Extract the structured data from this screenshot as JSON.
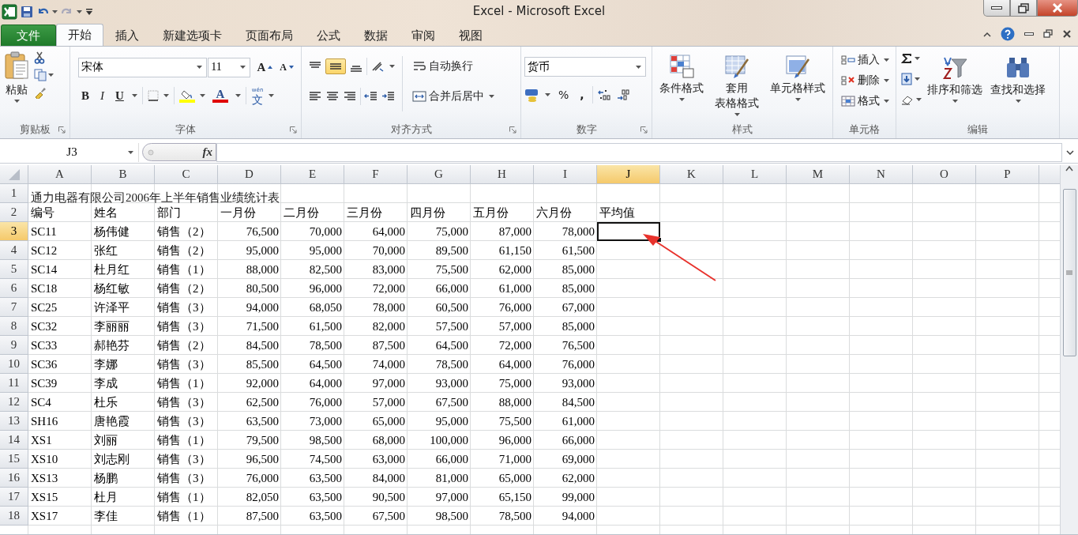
{
  "window": {
    "title": "Excel - Microsoft Excel"
  },
  "tabs": [
    {
      "label": "文件",
      "kind": "file",
      "selected": false
    },
    {
      "label": "开始",
      "kind": "tab",
      "selected": true
    },
    {
      "label": "插入",
      "kind": "tab",
      "selected": false
    },
    {
      "label": "新建选项卡",
      "kind": "tab",
      "selected": false
    },
    {
      "label": "页面布局",
      "kind": "tab",
      "selected": false
    },
    {
      "label": "公式",
      "kind": "tab",
      "selected": false
    },
    {
      "label": "数据",
      "kind": "tab",
      "selected": false
    },
    {
      "label": "审阅",
      "kind": "tab",
      "selected": false
    },
    {
      "label": "视图",
      "kind": "tab",
      "selected": false
    }
  ],
  "ribbon": {
    "clipboard": {
      "name": "剪贴板",
      "paste": "粘贴"
    },
    "font": {
      "name": "字体",
      "font_name": "宋体",
      "font_size": "11",
      "grow": "A",
      "shrink": "A",
      "bold": "B",
      "italic": "I",
      "underline": "U",
      "font_color": "A",
      "phonetic_top": "wén",
      "phonetic": "文"
    },
    "alignment": {
      "name": "对齐方式",
      "middle_align_selected": true,
      "wrap": "自动换行",
      "merge": "合并后居中"
    },
    "number": {
      "name": "数字",
      "format": "货币",
      "percent": "%",
      "comma": ","
    },
    "styles": {
      "name": "样式",
      "conditional": "条件格式",
      "table_1": "套用",
      "table_2": "表格格式",
      "cell_styles": "单元格样式"
    },
    "cells": {
      "name": "单元格",
      "insert": "插入",
      "delete": "删除",
      "format": "格式"
    },
    "editing": {
      "name": "编辑",
      "sort": "排序和筛选",
      "find": "查找和选择"
    }
  },
  "formula_bar": {
    "name_box": "J3",
    "function_label": "fx"
  },
  "sheet": {
    "columns": [
      {
        "label": "A",
        "selected": false
      },
      {
        "label": "B",
        "selected": false
      },
      {
        "label": "C",
        "selected": false
      },
      {
        "label": "D",
        "selected": false
      },
      {
        "label": "E",
        "selected": false
      },
      {
        "label": "F",
        "selected": false
      },
      {
        "label": "G",
        "selected": false
      },
      {
        "label": "H",
        "selected": false
      },
      {
        "label": "I",
        "selected": false
      },
      {
        "label": "J",
        "selected": true
      },
      {
        "label": "K",
        "selected": false
      },
      {
        "label": "L",
        "selected": false
      },
      {
        "label": "M",
        "selected": false
      },
      {
        "label": "N",
        "selected": false
      },
      {
        "label": "O",
        "selected": false
      },
      {
        "label": "P",
        "selected": false
      }
    ],
    "rows": [
      {
        "number": "1",
        "kind": "title",
        "selected": false,
        "cells": [
          "通力电器有限公司2006年上半年销售业绩统计表"
        ]
      },
      {
        "number": "2",
        "kind": "header",
        "selected": false,
        "cells": [
          "编号",
          "姓名",
          "部门",
          "一月份",
          "二月份",
          "三月份",
          "四月份",
          "五月份",
          "六月份",
          "平均值"
        ]
      },
      {
        "number": "3",
        "kind": "data",
        "selected": true,
        "cells": [
          "SC11",
          "杨伟健",
          "销售（2）",
          "76,500",
          "70,000",
          "64,000",
          "75,000",
          "87,000",
          "78,000"
        ]
      },
      {
        "number": "4",
        "kind": "data",
        "selected": false,
        "cells": [
          "SC12",
          "张红",
          "销售（2）",
          "95,000",
          "95,000",
          "70,000",
          "89,500",
          "61,150",
          "61,500"
        ]
      },
      {
        "number": "5",
        "kind": "data",
        "selected": false,
        "cells": [
          "SC14",
          "杜月红",
          "销售（1）",
          "88,000",
          "82,500",
          "83,000",
          "75,500",
          "62,000",
          "85,000"
        ]
      },
      {
        "number": "6",
        "kind": "data",
        "selected": false,
        "cells": [
          "SC18",
          "杨红敏",
          "销售（2）",
          "80,500",
          "96,000",
          "72,000",
          "66,000",
          "61,000",
          "85,000"
        ]
      },
      {
        "number": "7",
        "kind": "data",
        "selected": false,
        "cells": [
          "SC25",
          "许泽平",
          "销售（3）",
          "94,000",
          "68,050",
          "78,000",
          "60,500",
          "76,000",
          "67,000"
        ]
      },
      {
        "number": "8",
        "kind": "data",
        "selected": false,
        "cells": [
          "SC32",
          "李丽丽",
          "销售（3）",
          "71,500",
          "61,500",
          "82,000",
          "57,500",
          "57,000",
          "85,000"
        ]
      },
      {
        "number": "9",
        "kind": "data",
        "selected": false,
        "cells": [
          "SC33",
          "郝艳芬",
          "销售（2）",
          "84,500",
          "78,500",
          "87,500",
          "64,500",
          "72,000",
          "76,500"
        ]
      },
      {
        "number": "10",
        "kind": "data",
        "selected": false,
        "cells": [
          "SC36",
          "李娜",
          "销售（3）",
          "85,500",
          "64,500",
          "74,000",
          "78,500",
          "64,000",
          "76,000"
        ]
      },
      {
        "number": "11",
        "kind": "data",
        "selected": false,
        "cells": [
          "SC39",
          "李成",
          "销售（1）",
          "92,000",
          "64,000",
          "97,000",
          "93,000",
          "75,000",
          "93,000"
        ]
      },
      {
        "number": "12",
        "kind": "data",
        "selected": false,
        "cells": [
          "SC4",
          "杜乐",
          "销售（3）",
          "62,500",
          "76,000",
          "57,000",
          "67,500",
          "88,000",
          "84,500"
        ]
      },
      {
        "number": "13",
        "kind": "data",
        "selected": false,
        "cells": [
          "SH16",
          "唐艳霞",
          "销售（3）",
          "63,500",
          "73,000",
          "65,000",
          "95,000",
          "75,500",
          "61,000"
        ]
      },
      {
        "number": "14",
        "kind": "data",
        "selected": false,
        "cells": [
          "XS1",
          "刘丽",
          "销售（1）",
          "79,500",
          "98,500",
          "68,000",
          "100,000",
          "96,000",
          "66,000"
        ]
      },
      {
        "number": "15",
        "kind": "data",
        "selected": false,
        "cells": [
          "XS10",
          "刘志刚",
          "销售（3）",
          "96,500",
          "74,500",
          "63,000",
          "66,000",
          "71,000",
          "69,000"
        ]
      },
      {
        "number": "16",
        "kind": "data",
        "selected": false,
        "cells": [
          "XS13",
          "杨鹏",
          "销售（3）",
          "76,000",
          "63,500",
          "84,000",
          "81,000",
          "65,000",
          "62,000"
        ]
      },
      {
        "number": "17",
        "kind": "data",
        "selected": false,
        "cells": [
          "XS15",
          "杜月",
          "销售（1）",
          "82,050",
          "63,500",
          "90,500",
          "97,000",
          "65,150",
          "99,000"
        ]
      },
      {
        "number": "18",
        "kind": "data",
        "selected": false,
        "cells": [
          "XS17",
          "李佳",
          "销售（1）",
          "87,500",
          "63,500",
          "67,500",
          "98,500",
          "78,500",
          "94,000"
        ]
      }
    ]
  }
}
